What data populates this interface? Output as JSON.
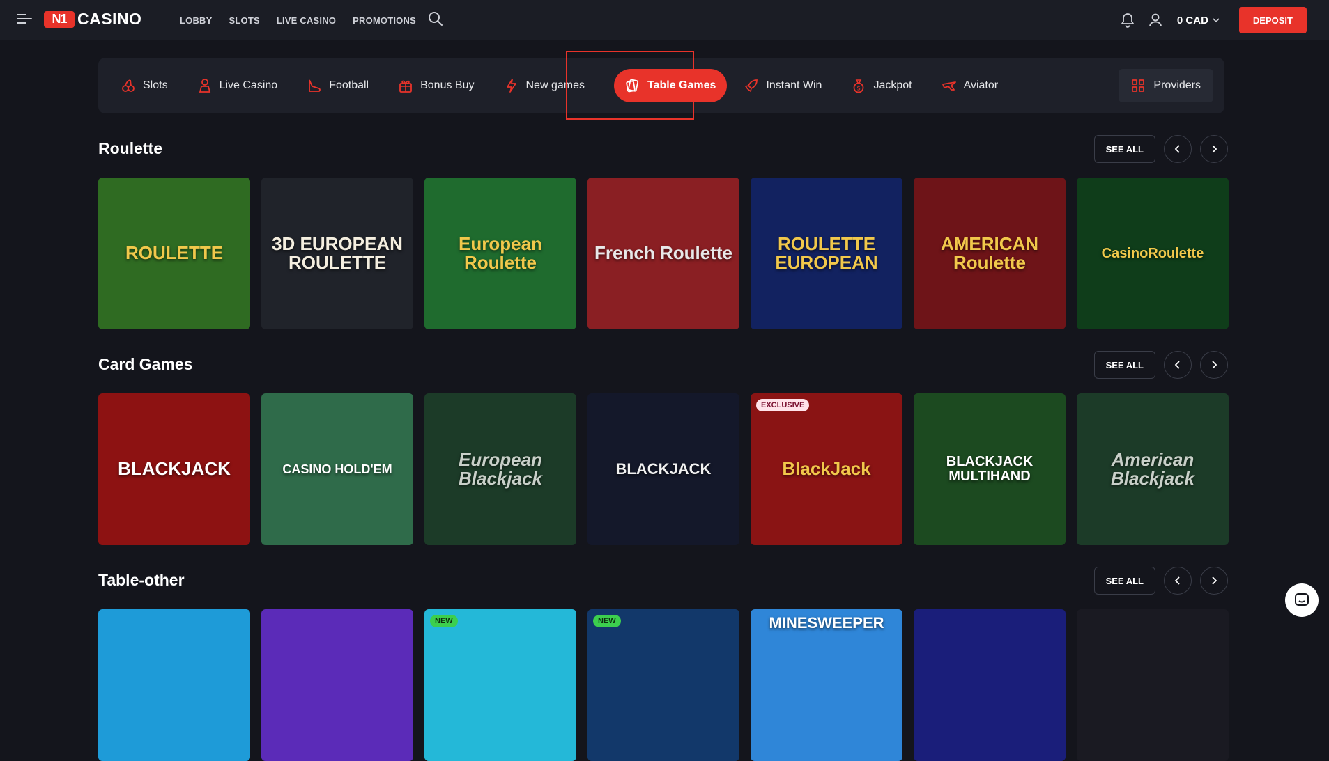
{
  "header": {
    "logo_mark": "N1",
    "logo_text": "CASINO",
    "nav": [
      "LOBBY",
      "SLOTS",
      "LIVE CASINO",
      "PROMOTIONS"
    ],
    "balance": "0 CAD",
    "deposit_label": "DEPOSIT"
  },
  "categories": {
    "items": [
      {
        "label": "Slots",
        "icon": "cherry-icon"
      },
      {
        "label": "Live Casino",
        "icon": "dealer-icon"
      },
      {
        "label": "Football",
        "icon": "football-boot-icon"
      },
      {
        "label": "Bonus Buy",
        "icon": "gift-icon"
      },
      {
        "label": "New games",
        "icon": "lightning-icon"
      },
      {
        "label": "Table Games",
        "icon": "cards-icon",
        "active": true
      },
      {
        "label": "Instant Win",
        "icon": "rocket-icon"
      },
      {
        "label": "Jackpot",
        "icon": "money-bag-icon"
      },
      {
        "label": "Aviator",
        "icon": "plane-icon"
      }
    ],
    "providers_label": "Providers"
  },
  "sections": [
    {
      "title": "Roulette",
      "see_all": "SEE ALL",
      "tiles": [
        {
          "text": "ROULETTE",
          "bg": "#2f6b22"
        },
        {
          "text": "3D EUROPEAN ROULETTE",
          "bg": "#20232a"
        },
        {
          "text": "European Roulette",
          "bg": "#1f6b2e"
        },
        {
          "text": "French Roulette",
          "bg": "#8a1f23"
        },
        {
          "text": "ROULETTE EUROPEAN",
          "bg": "#122260"
        },
        {
          "text": "AMERICAN Roulette",
          "bg": "#6e1418"
        },
        {
          "text": "CasinoRoulette",
          "bg": "#0f3d1a"
        }
      ]
    },
    {
      "title": "Card Games",
      "see_all": "SEE ALL",
      "tiles": [
        {
          "text": "BLACKJACK",
          "bg": "#8d1212"
        },
        {
          "text": "CASINO HOLD'EM",
          "bg": "#2f6b4a"
        },
        {
          "text": "European Blackjack",
          "bg": "#1c3b28"
        },
        {
          "text": "BLACKJACK",
          "bg": "#14182a"
        },
        {
          "text": "BlackJack",
          "bg": "#8a1414",
          "badge": "EXCLUSIVE"
        },
        {
          "text": "BLACKJACK MULTIHAND",
          "bg": "#1c4a20"
        },
        {
          "text": "American Blackjack",
          "bg": "#1c3b28"
        }
      ]
    },
    {
      "title": "Table-other",
      "see_all": "SEE ALL",
      "tiles": [
        {
          "text": "",
          "bg": "#1e9bd8"
        },
        {
          "text": "",
          "bg": "#5b2bb8"
        },
        {
          "text": "",
          "bg": "#24b8d8",
          "badge": "NEW"
        },
        {
          "text": "",
          "bg": "#12386a",
          "badge": "NEW"
        },
        {
          "text": "MINESWEEPER",
          "bg": "#2f86d8"
        },
        {
          "text": "",
          "bg": "#1a1e7a"
        },
        {
          "text": "",
          "bg": "#1a1a22"
        }
      ]
    }
  ]
}
